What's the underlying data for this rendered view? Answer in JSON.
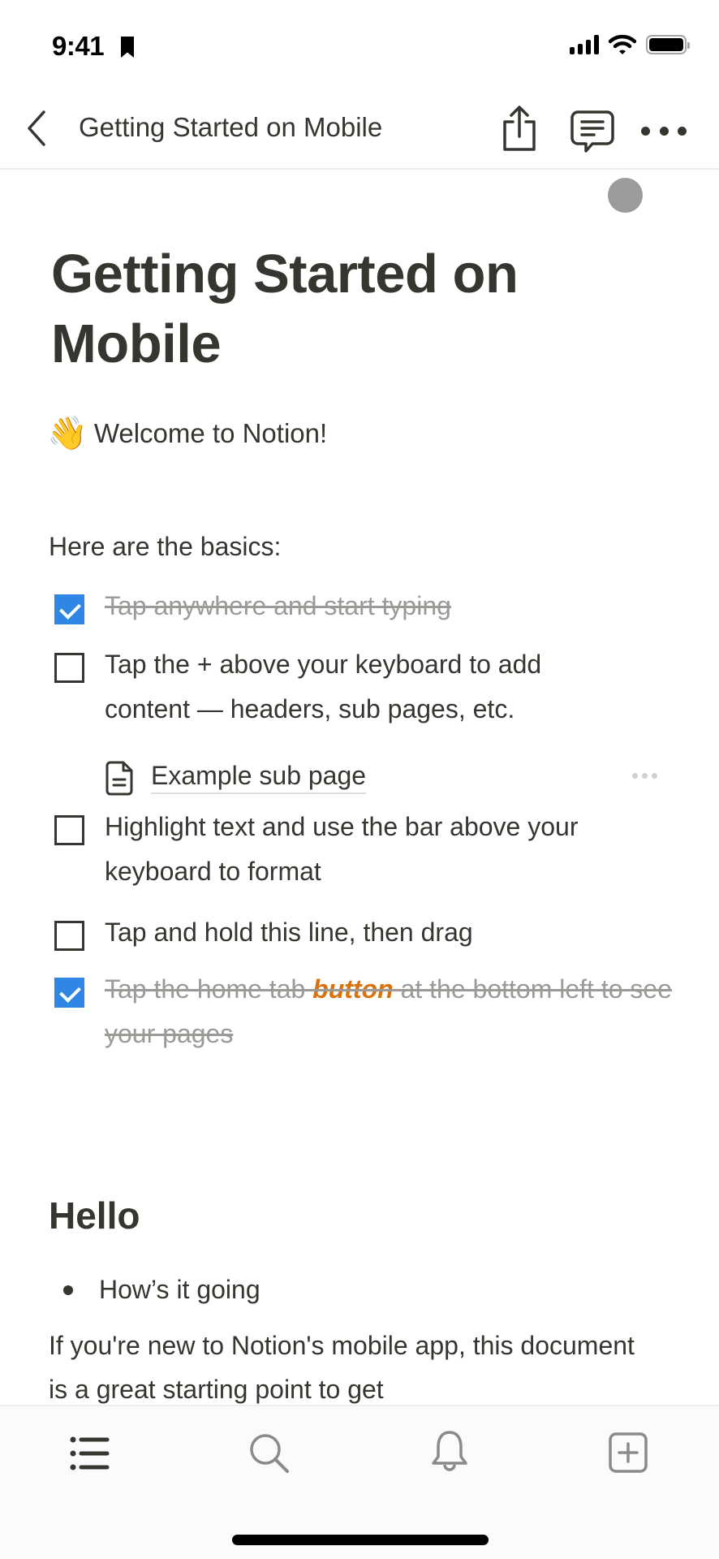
{
  "status_bar": {
    "time": "9:41",
    "icons": [
      "bookmark-icon",
      "signal-icon",
      "wifi-icon",
      "battery-icon"
    ]
  },
  "nav": {
    "title": "Getting Started on Mobile",
    "back_icon": "chevron-left-icon",
    "actions": [
      "share-icon",
      "comment-icon",
      "more-icon"
    ]
  },
  "page": {
    "title": "Getting Started on Mobile",
    "welcome_emoji": "👋",
    "welcome_text": "Welcome to Notion!",
    "basics_label": "Here are the basics:",
    "todos": [
      {
        "text": "Tap anywhere and start typing",
        "checked": true
      },
      {
        "text": "Tap the + above your keyboard to add content — headers, sub pages, etc.",
        "checked": false
      },
      {
        "text": "Highlight text and use the bar above your keyboard to format",
        "checked": false
      },
      {
        "text": "Tap and hold this line, then drag",
        "checked": false
      },
      {
        "text_before": "Tap the home tab ",
        "text_accent": "button",
        "text_after": " at the bottom left to see your pages",
        "checked": true
      }
    ],
    "subpage": {
      "label": "Example sub page",
      "icon": "page-icon"
    },
    "heading": "Hello",
    "bullets": [
      "How’s it going"
    ],
    "paragraph": "If you're new to Notion's mobile app, this document is a great starting point to get"
  },
  "tab_bar": {
    "tabs": [
      {
        "name": "pages",
        "icon": "list-icon",
        "active": true
      },
      {
        "name": "search",
        "icon": "search-icon",
        "active": false
      },
      {
        "name": "updates",
        "icon": "bell-icon",
        "active": false
      },
      {
        "name": "new-page",
        "icon": "new-page-icon",
        "active": false
      }
    ]
  },
  "colors": {
    "text": "#37352f",
    "muted": "#9b9a97",
    "checkbox_checked": "#2e87e5",
    "accent_orange": "#d9730d",
    "presence": "#9b9b9b"
  }
}
